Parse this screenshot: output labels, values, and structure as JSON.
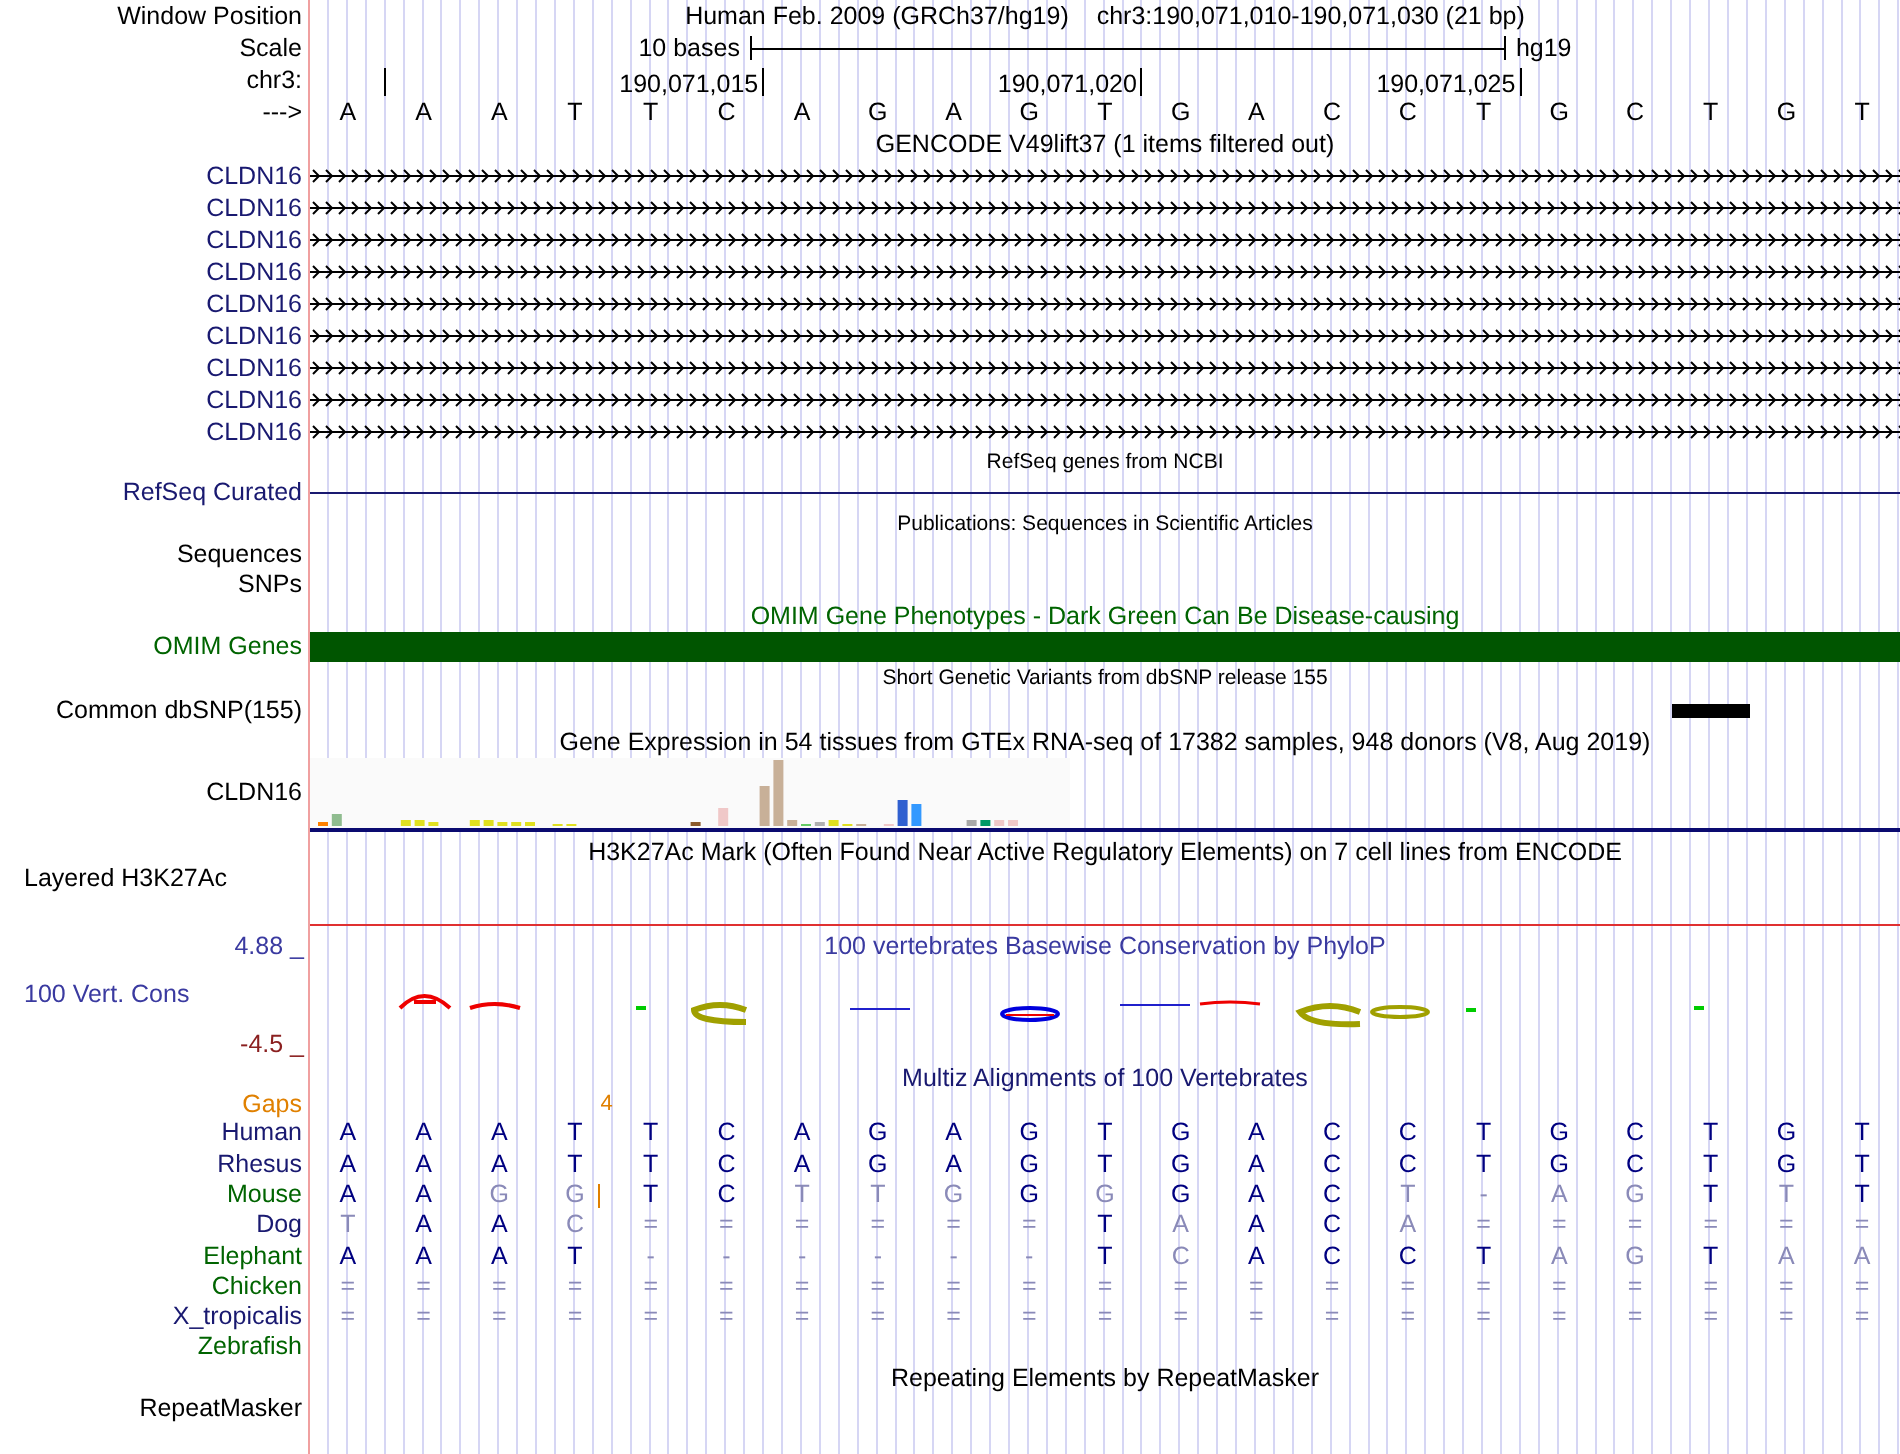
{
  "header": {
    "window_position_label": "Window Position",
    "assembly": "Human Feb. 2009 (GRCh37/hg19)",
    "position": "chr3:190,071,010-190,071,030 (21 bp)",
    "scale_label": "Scale",
    "scale_text": "10 bases",
    "scale_db": "hg19",
    "chrom_label": "chr3:",
    "tick_labels": [
      "190,071,015",
      "190,071,020",
      "190,071,025"
    ],
    "strand_label": "--->",
    "bases": [
      "A",
      "A",
      "A",
      "T",
      "T",
      "C",
      "A",
      "G",
      "A",
      "G",
      "T",
      "G",
      "A",
      "C",
      "C",
      "T",
      "G",
      "C",
      "T",
      "G",
      "T"
    ]
  },
  "tracks": [
    {
      "kind": "genes",
      "title": "GENCODE V49lift37 (1 items filtered out)",
      "items": [
        {
          "label": "CLDN16"
        },
        {
          "label": "CLDN16"
        },
        {
          "label": "CLDN16"
        },
        {
          "label": "CLDN16"
        },
        {
          "label": "CLDN16"
        },
        {
          "label": "CLDN16"
        },
        {
          "label": "CLDN16"
        },
        {
          "label": "CLDN16"
        },
        {
          "label": "CLDN16"
        }
      ]
    },
    {
      "kind": "line",
      "title": "RefSeq genes from NCBI",
      "label": "RefSeq Curated"
    },
    {
      "kind": "labels",
      "title": "Publications: Sequences in Scientific Articles",
      "labels": [
        "Sequences",
        "SNPs"
      ]
    },
    {
      "kind": "bar",
      "title": "OMIM Gene Phenotypes - Dark Green Can Be Disease-causing",
      "label": "OMIM Genes"
    },
    {
      "kind": "snp",
      "title": "Short Genetic Variants from dbSNP release 155",
      "label": "Common dbSNP(155)"
    },
    {
      "kind": "expression",
      "title": "Gene Expression in 54 tissues from GTEx RNA-seq of 17382 samples, 948 donors (V8, Aug 2019)",
      "label": "CLDN16"
    },
    {
      "kind": "signal",
      "title": "H3K27Ac Mark (Often Found Near Active Regulatory Elements) on 7 cell lines from ENCODE",
      "label": "Layered H3K27Ac"
    },
    {
      "kind": "conservation",
      "title": "100 vertebrates Basewise Conservation by PhyloP",
      "label": "100 Vert. Cons",
      "y_max": "4.88 _",
      "y_min": "-4.5 _"
    },
    {
      "kind": "alignment",
      "title": "Multiz Alignments of 100 Vertebrates",
      "gaps": {
        "label": "Gaps",
        "count": "4"
      },
      "species": [
        {
          "name": "Human",
          "color": "#191970",
          "bases": [
            {
              "base": "A",
              "matches": true
            },
            {
              "base": "A",
              "matches": true
            },
            {
              "base": "A",
              "matches": true
            },
            {
              "base": "T",
              "matches": true
            },
            {
              "base": "T",
              "matches": true
            },
            {
              "base": "C",
              "matches": true
            },
            {
              "base": "A",
              "matches": true
            },
            {
              "base": "G",
              "matches": true
            },
            {
              "base": "A",
              "matches": true
            },
            {
              "base": "G",
              "matches": true
            },
            {
              "base": "T",
              "matches": true
            },
            {
              "base": "G",
              "matches": true
            },
            {
              "base": "A",
              "matches": true
            },
            {
              "base": "C",
              "matches": true
            },
            {
              "base": "C",
              "matches": true
            },
            {
              "base": "T",
              "matches": true
            },
            {
              "base": "G",
              "matches": true
            },
            {
              "base": "C",
              "matches": true
            },
            {
              "base": "T",
              "matches": true
            },
            {
              "base": "G",
              "matches": true
            },
            {
              "base": "T",
              "matches": true
            }
          ]
        },
        {
          "name": "Rhesus",
          "color": "#191970",
          "bases": [
            {
              "base": "A",
              "matches": true
            },
            {
              "base": "A",
              "matches": true
            },
            {
              "base": "A",
              "matches": true
            },
            {
              "base": "T",
              "matches": true
            },
            {
              "base": "T",
              "matches": true
            },
            {
              "base": "C",
              "matches": true
            },
            {
              "base": "A",
              "matches": true
            },
            {
              "base": "G",
              "matches": true
            },
            {
              "base": "A",
              "matches": true
            },
            {
              "base": "G",
              "matches": true
            },
            {
              "base": "T",
              "matches": true
            },
            {
              "base": "G",
              "matches": true
            },
            {
              "base": "A",
              "matches": true
            },
            {
              "base": "C",
              "matches": true
            },
            {
              "base": "C",
              "matches": true
            },
            {
              "base": "T",
              "matches": true
            },
            {
              "base": "G",
              "matches": true
            },
            {
              "base": "C",
              "matches": true
            },
            {
              "base": "T",
              "matches": true
            },
            {
              "base": "G",
              "matches": true
            },
            {
              "base": "T",
              "matches": true
            }
          ]
        },
        {
          "name": "Mouse",
          "color": "#006400",
          "bases": [
            {
              "base": "A",
              "matches": true
            },
            {
              "base": "A",
              "matches": true
            },
            {
              "base": "G",
              "matches": false
            },
            {
              "base": "G",
              "matches": false,
              "insertion_after": true
            },
            {
              "base": "T",
              "matches": true
            },
            {
              "base": "C",
              "matches": true
            },
            {
              "base": "T",
              "matches": false
            },
            {
              "base": "T",
              "matches": false
            },
            {
              "base": "G",
              "matches": false
            },
            {
              "base": "G",
              "matches": true
            },
            {
              "base": "G",
              "matches": false
            },
            {
              "base": "G",
              "matches": true
            },
            {
              "base": "A",
              "matches": true
            },
            {
              "base": "C",
              "matches": true
            },
            {
              "base": "T",
              "matches": false
            },
            {
              "base": "-",
              "matches": false
            },
            {
              "base": "A",
              "matches": false
            },
            {
              "base": "G",
              "matches": false
            },
            {
              "base": "T",
              "matches": true
            },
            {
              "base": "T",
              "matches": false
            },
            {
              "base": "T",
              "matches": true
            }
          ]
        },
        {
          "name": "Dog",
          "color": "#191970",
          "bases": [
            {
              "base": "T",
              "matches": false
            },
            {
              "base": "A",
              "matches": true
            },
            {
              "base": "A",
              "matches": true
            },
            {
              "base": "C",
              "matches": false
            },
            {
              "base": "=",
              "matches": false
            },
            {
              "base": "=",
              "matches": false
            },
            {
              "base": "=",
              "matches": false
            },
            {
              "base": "=",
              "matches": false
            },
            {
              "base": "=",
              "matches": false
            },
            {
              "base": "=",
              "matches": false
            },
            {
              "base": "T",
              "matches": true
            },
            {
              "base": "A",
              "matches": false
            },
            {
              "base": "A",
              "matches": true
            },
            {
              "base": "C",
              "matches": true
            },
            {
              "base": "A",
              "matches": false
            },
            {
              "base": "=",
              "matches": false
            },
            {
              "base": "=",
              "matches": false
            },
            {
              "base": "=",
              "matches": false
            },
            {
              "base": "=",
              "matches": false
            },
            {
              "base": "=",
              "matches": false
            },
            {
              "base": "=",
              "matches": false
            }
          ]
        },
        {
          "name": "Elephant",
          "color": "#006400",
          "bases": [
            {
              "base": "A",
              "matches": true
            },
            {
              "base": "A",
              "matches": true
            },
            {
              "base": "A",
              "matches": true
            },
            {
              "base": "T",
              "matches": true
            },
            {
              "base": "-",
              "matches": false
            },
            {
              "base": "-",
              "matches": false
            },
            {
              "base": "-",
              "matches": false
            },
            {
              "base": "-",
              "matches": false
            },
            {
              "base": "-",
              "matches": false
            },
            {
              "base": "-",
              "matches": false
            },
            {
              "base": "T",
              "matches": true
            },
            {
              "base": "C",
              "matches": false
            },
            {
              "base": "A",
              "matches": true
            },
            {
              "base": "C",
              "matches": true
            },
            {
              "base": "C",
              "matches": true
            },
            {
              "base": "T",
              "matches": true
            },
            {
              "base": "A",
              "matches": false
            },
            {
              "base": "G",
              "matches": false
            },
            {
              "base": "T",
              "matches": true
            },
            {
              "base": "A",
              "matches": false
            },
            {
              "base": "A",
              "matches": false
            }
          ]
        },
        {
          "name": "Chicken",
          "color": "#006400",
          "bases": [
            {
              "base": "=",
              "matches": false
            },
            {
              "base": "=",
              "matches": false
            },
            {
              "base": "=",
              "matches": false
            },
            {
              "base": "=",
              "matches": false
            },
            {
              "base": "=",
              "matches": false
            },
            {
              "base": "=",
              "matches": false
            },
            {
              "base": "=",
              "matches": false
            },
            {
              "base": "=",
              "matches": false
            },
            {
              "base": "=",
              "matches": false
            },
            {
              "base": "=",
              "matches": false
            },
            {
              "base": "=",
              "matches": false
            },
            {
              "base": "=",
              "matches": false
            },
            {
              "base": "=",
              "matches": false
            },
            {
              "base": "=",
              "matches": false
            },
            {
              "base": "=",
              "matches": false
            },
            {
              "base": "=",
              "matches": false
            },
            {
              "base": "=",
              "matches": false
            },
            {
              "base": "=",
              "matches": false
            },
            {
              "base": "=",
              "matches": false
            },
            {
              "base": "=",
              "matches": false
            },
            {
              "base": "=",
              "matches": false
            }
          ]
        },
        {
          "name": "X_tropicalis",
          "color": "#191970",
          "bases": [
            {
              "base": "=",
              "matches": false
            },
            {
              "base": "=",
              "matches": false
            },
            {
              "base": "=",
              "matches": false
            },
            {
              "base": "=",
              "matches": false
            },
            {
              "base": "=",
              "matches": false
            },
            {
              "base": "=",
              "matches": false
            },
            {
              "base": "=",
              "matches": false
            },
            {
              "base": "=",
              "matches": false
            },
            {
              "base": "=",
              "matches": false
            },
            {
              "base": "=",
              "matches": false
            },
            {
              "base": "=",
              "matches": false
            },
            {
              "base": "=",
              "matches": false
            },
            {
              "base": "=",
              "matches": false
            },
            {
              "base": "=",
              "matches": false
            },
            {
              "base": "=",
              "matches": false
            },
            {
              "base": "=",
              "matches": false
            },
            {
              "base": "=",
              "matches": false
            },
            {
              "base": "=",
              "matches": false
            },
            {
              "base": "=",
              "matches": false
            },
            {
              "base": "=",
              "matches": false
            },
            {
              "base": "=",
              "matches": false
            }
          ]
        },
        {
          "name": "Zebrafish",
          "color": "#006400"
        }
      ]
    },
    {
      "kind": "repeats",
      "title": "Repeating Elements by RepeatMasker",
      "label": "RepeatMasker"
    }
  ]
}
